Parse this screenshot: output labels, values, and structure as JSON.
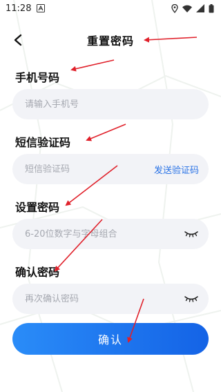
{
  "status_bar": {
    "time": "11:28"
  },
  "header": {
    "title": "重置密码"
  },
  "phone": {
    "label": "手机号码",
    "placeholder": "请输入手机号"
  },
  "sms_code": {
    "label": "短信验证码",
    "placeholder": "短信验证码",
    "send_label": "发送验证码"
  },
  "password": {
    "label": "设置密码",
    "placeholder": "6-20位数字与字母组合"
  },
  "confirm_password": {
    "label": "确认密码",
    "placeholder": "再次确认密码"
  },
  "confirm_button": {
    "label": "确认"
  },
  "colors": {
    "accent": "#2a73e6",
    "annotation": "#e0202a",
    "field_bg": "#f2f3f7"
  },
  "icons": [
    "a-notification-icon",
    "location-icon",
    "wifi-icon",
    "signal-icon",
    "battery-icon",
    "back-arrow-icon",
    "eye-closed-icon"
  ]
}
